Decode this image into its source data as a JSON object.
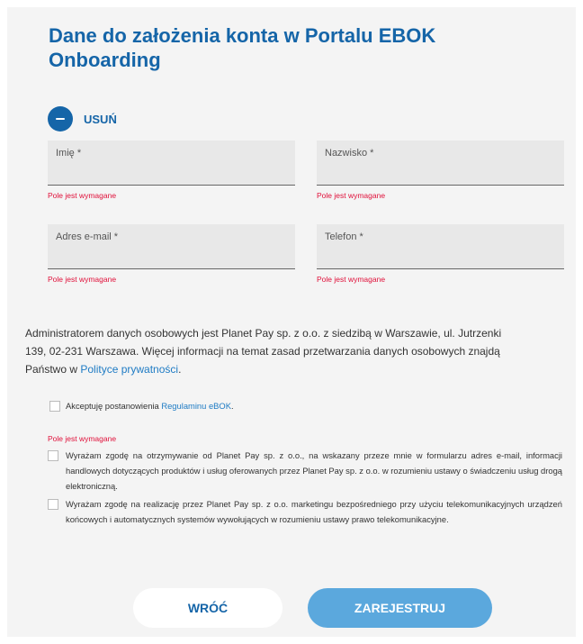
{
  "header": {
    "title": "Dane do założenia konta w Portalu EBOK Onboarding"
  },
  "remove": {
    "label": "USUŃ",
    "icon": "minus-icon"
  },
  "form": {
    "first_name": {
      "label": "Imię *",
      "error": "Pole jest wymagane"
    },
    "last_name": {
      "label": "Nazwisko *",
      "error": "Pole jest wymagane"
    },
    "email": {
      "label": "Adres e-mail *",
      "error": "Pole jest wymagane"
    },
    "phone": {
      "label": "Telefon *",
      "error": "Pole jest wymagane"
    }
  },
  "info": {
    "text": "Administratorem danych osobowych jest Planet Pay sp. z o.o. z siedzibą w Warszawie, ul. Jutrzenki 139, 02-231 Warszawa. Więcej informacji na temat zasad przetwarzania danych osobowych znajdą Państwo w ",
    "link": "Polityce prywatności",
    "end": "."
  },
  "terms": {
    "text": "Akceptuję postanowienia ",
    "link": "Regulaminu eBOK",
    "end": ".",
    "error": "Pole jest wymagane"
  },
  "consents": [
    {
      "text": "Wyrażam zgodę na otrzymywanie od Planet Pay sp. z o.o., na wskazany przeze mnie w formularzu adres e-mail, informacji handlowych dotyczących produktów i usług oferowanych przez Planet Pay sp. z o.o. w rozumieniu ustawy o świadczeniu usług drogą elektroniczną."
    },
    {
      "text": "Wyrażam zgodę na realizację przez Planet Pay sp. z o.o. marketingu bezpośredniego przy użyciu telekomunikacyjnych urządzeń końcowych i automatycznych systemów wywołujących w rozumieniu ustawy prawo telekomunikacyjne."
    }
  ],
  "buttons": {
    "back": "WRÓĆ",
    "register": "ZAREJESTRUJ"
  },
  "colors": {
    "primary": "#1565a8",
    "accent": "#5ba8dd",
    "error": "#e0103a",
    "link": "#1e7bc4"
  }
}
